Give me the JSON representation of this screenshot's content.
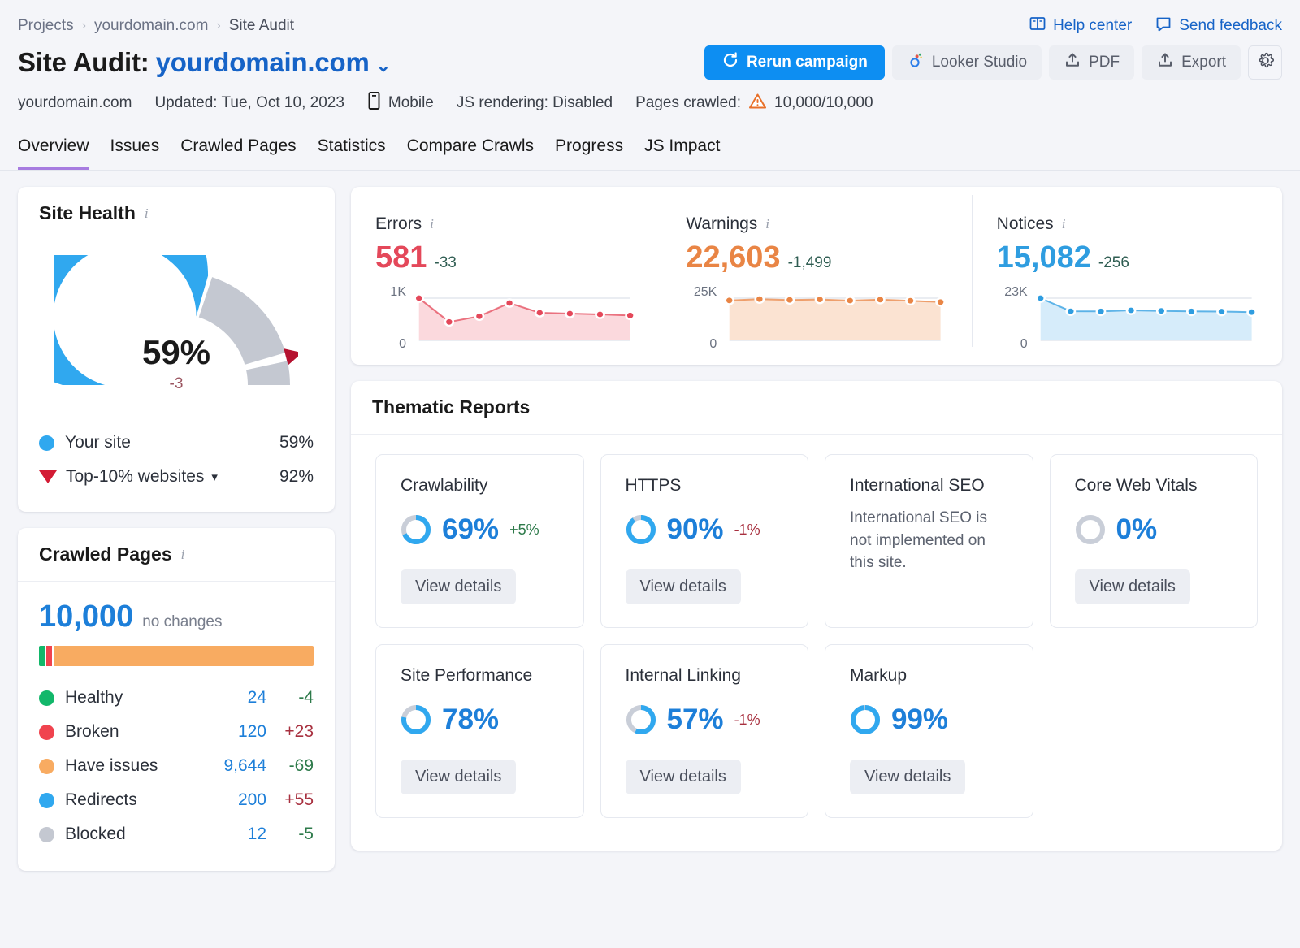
{
  "breadcrumb": {
    "items": [
      "Projects",
      "yourdomain.com",
      "Site Audit"
    ],
    "separator": "›"
  },
  "top_links": {
    "help": "Help center",
    "feedback": "Send feedback"
  },
  "header": {
    "title_prefix": "Site Audit:",
    "domain": "yourdomain.com",
    "caret": "⌄"
  },
  "actions": {
    "rerun": "Rerun campaign",
    "looker": "Looker Studio",
    "pdf": "PDF",
    "export": "Export"
  },
  "meta": {
    "domain": "yourdomain.com",
    "updated": "Updated: Tue, Oct 10, 2023",
    "device": "Mobile",
    "js_rendering": "JS rendering: Disabled",
    "pages_crawled_label": "Pages crawled:",
    "pages_crawled_value": "10,000/10,000"
  },
  "tabs": [
    {
      "label": "Overview",
      "active": true
    },
    {
      "label": "Issues",
      "active": false
    },
    {
      "label": "Crawled Pages",
      "active": false
    },
    {
      "label": "Statistics",
      "active": false
    },
    {
      "label": "Compare Crawls",
      "active": false
    },
    {
      "label": "Progress",
      "active": false
    },
    {
      "label": "JS Impact",
      "active": false
    }
  ],
  "site_health": {
    "title": "Site Health",
    "value_label": "59%",
    "delta_label": "-3",
    "legend": [
      {
        "name": "Your site",
        "value": "59%",
        "color": "#30a8ef",
        "marker": "dot"
      },
      {
        "name": "Top-10% websites",
        "value": "92%",
        "color": "#d31b34",
        "marker": "triangle",
        "has_dropdown": true
      }
    ]
  },
  "crawled_pages": {
    "title": "Crawled Pages",
    "total": "10,000",
    "note": "no changes",
    "rows": [
      {
        "name": "Healthy",
        "count": "24",
        "delta": "-4",
        "delta_dir": "down",
        "color": "#12b76a"
      },
      {
        "name": "Broken",
        "count": "120",
        "delta": "+23",
        "delta_dir": "up",
        "color": "#f0434e"
      },
      {
        "name": "Have issues",
        "count": "9,644",
        "delta": "-69",
        "delta_dir": "down",
        "color": "#f8ab61"
      },
      {
        "name": "Redirects",
        "count": "200",
        "delta": "+55",
        "delta_dir": "up",
        "color": "#30a8ef"
      },
      {
        "name": "Blocked",
        "count": "12",
        "delta": "-5",
        "delta_dir": "down",
        "color": "#c4c8d1"
      }
    ]
  },
  "stats": [
    {
      "name": "Errors",
      "value": "581",
      "delta": "-33",
      "color": "#e4485a",
      "fill": "#fbd9dd",
      "axis_hi": "1K",
      "axis_lo": "0"
    },
    {
      "name": "Warnings",
      "value": "22,603",
      "delta": "-1,499",
      "color": "#e98545",
      "fill": "#fbe3d2",
      "axis_hi": "25K",
      "axis_lo": "0"
    },
    {
      "name": "Notices",
      "value": "15,082",
      "delta": "-256",
      "color": "#2f9de0",
      "fill": "#d6ecfa",
      "axis_hi": "23K",
      "axis_lo": "0"
    }
  ],
  "thematic": {
    "title": "Thematic Reports",
    "view_details": "View details",
    "cards": [
      {
        "name": "Crawlability",
        "percent": 69,
        "percent_label": "69%",
        "delta": "+5%",
        "delta_dir": "pos"
      },
      {
        "name": "HTTPS",
        "percent": 90,
        "percent_label": "90%",
        "delta": "-1%",
        "delta_dir": "neg"
      },
      {
        "name": "International SEO",
        "percent": null,
        "percent_label": null,
        "delta": null,
        "delta_dir": null,
        "description": "International SEO is not implemented on this site."
      },
      {
        "name": "Core Web Vitals",
        "percent": 0,
        "percent_label": "0%",
        "delta": null,
        "delta_dir": null
      },
      {
        "name": "Site Performance",
        "percent": 78,
        "percent_label": "78%",
        "delta": null,
        "delta_dir": null
      },
      {
        "name": "Internal Linking",
        "percent": 57,
        "percent_label": "57%",
        "delta": "-1%",
        "delta_dir": "neg"
      },
      {
        "name": "Markup",
        "percent": 99,
        "percent_label": "99%",
        "delta": null,
        "delta_dir": null
      }
    ]
  },
  "chart_data": [
    {
      "type": "gauge",
      "title": "Site Health",
      "value": 59,
      "delta": -3,
      "benchmark": 92,
      "range": [
        0,
        100
      ],
      "series": [
        {
          "name": "Your site",
          "value": 59,
          "color": "#30a8ef"
        },
        {
          "name": "Top-10% websites",
          "value": 92,
          "color": "#d31b34"
        }
      ]
    },
    {
      "type": "bar",
      "title": "Crawled Pages",
      "orientation": "stacked-horizontal",
      "total": 10000,
      "categories": [
        "Healthy",
        "Broken",
        "Have issues",
        "Redirects",
        "Blocked"
      ],
      "values": [
        24,
        120,
        9644,
        200,
        12
      ],
      "deltas": [
        -4,
        23,
        -69,
        55,
        -5
      ],
      "colors": [
        "#12b76a",
        "#f0434e",
        "#f8ab61",
        "#30a8ef",
        "#c4c8d1"
      ]
    },
    {
      "type": "area",
      "title": "Errors",
      "ylabel": "",
      "xlabel": "",
      "ylim": [
        0,
        1000
      ],
      "tick_labels": [
        "1K",
        "0"
      ],
      "x": [
        1,
        2,
        3,
        4,
        5,
        6,
        7,
        8
      ],
      "values": [
        1000,
        415,
        555,
        880,
        640,
        620,
        600,
        575
      ],
      "current": 581,
      "delta": -33,
      "color": "#e4485a",
      "fill": "#fbd9dd",
      "grid": false
    },
    {
      "type": "area",
      "title": "Warnings",
      "ylabel": "",
      "xlabel": "",
      "ylim": [
        0,
        25000
      ],
      "tick_labels": [
        "25K",
        "0"
      ],
      "x": [
        1,
        2,
        3,
        4,
        5,
        6,
        7,
        8
      ],
      "values": [
        23600,
        24400,
        23900,
        24200,
        23500,
        24100,
        23400,
        22603
      ],
      "current": 22603,
      "delta": -1499,
      "color": "#e98545",
      "fill": "#fbe3d2",
      "grid": false
    },
    {
      "type": "area",
      "title": "Notices",
      "ylabel": "",
      "xlabel": "",
      "ylim": [
        0,
        23000
      ],
      "tick_labels": [
        "23K",
        "0"
      ],
      "x": [
        1,
        2,
        3,
        4,
        5,
        6,
        7,
        8
      ],
      "values": [
        23000,
        15600,
        15500,
        16100,
        15800,
        15500,
        15400,
        15082
      ],
      "current": 15082,
      "delta": -256,
      "color": "#2f9de0",
      "fill": "#d6ecfa",
      "grid": false
    },
    {
      "type": "pie",
      "title": "Thematic Reports donuts",
      "categories": [
        "Crawlability",
        "HTTPS",
        "Core Web Vitals",
        "Site Performance",
        "Internal Linking",
        "Markup"
      ],
      "values": [
        69,
        90,
        0,
        78,
        57,
        99
      ],
      "track_color": "#c9ced8",
      "fill_color": "#30a8ef"
    }
  ]
}
